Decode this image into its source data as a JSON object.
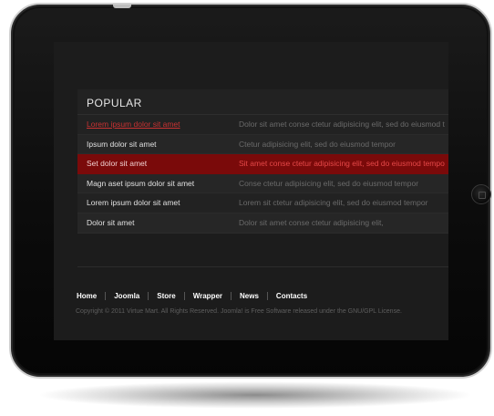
{
  "popular": {
    "title": "POPULAR",
    "items": [
      {
        "title": "Lorem ipsum dolor sit amet",
        "desc": "Dolor sit amet conse ctetur adipisicing elit, sed do eiusmod t"
      },
      {
        "title": "Ipsum dolor sit amet",
        "desc": "Ctetur adipisicing elit, sed do eiusmod tempor"
      },
      {
        "title": "Set dolor sit amet",
        "desc": "Sit amet conse ctetur adipisicing elit, sed do eiusmod tempo"
      },
      {
        "title": "Magn aset  ipsum dolor sit amet",
        "desc": "Conse ctetur adipisicing elit, sed do eiusmod tempor"
      },
      {
        "title": "Lorem ipsum dolor sit amet",
        "desc": "Lorem sit ctetur adipisicing elit, sed do eiusmod tempor"
      },
      {
        "title": "Dolor sit amet",
        "desc": "Dolor sit amet conse ctetur adipisicing elit,"
      }
    ]
  },
  "footer": {
    "nav": [
      "Home",
      "Joomla",
      "Store",
      "Wrapper",
      "News",
      "Contacts"
    ],
    "copyright": "Copyright © 2011  Virtue Mart.  All Rights Reserved. Joomla! is Free Software released under the GNU/GPL License."
  },
  "colors": {
    "accent": "#7a0a0a",
    "link_red": "#c83232",
    "background": "#1c1c1c"
  }
}
